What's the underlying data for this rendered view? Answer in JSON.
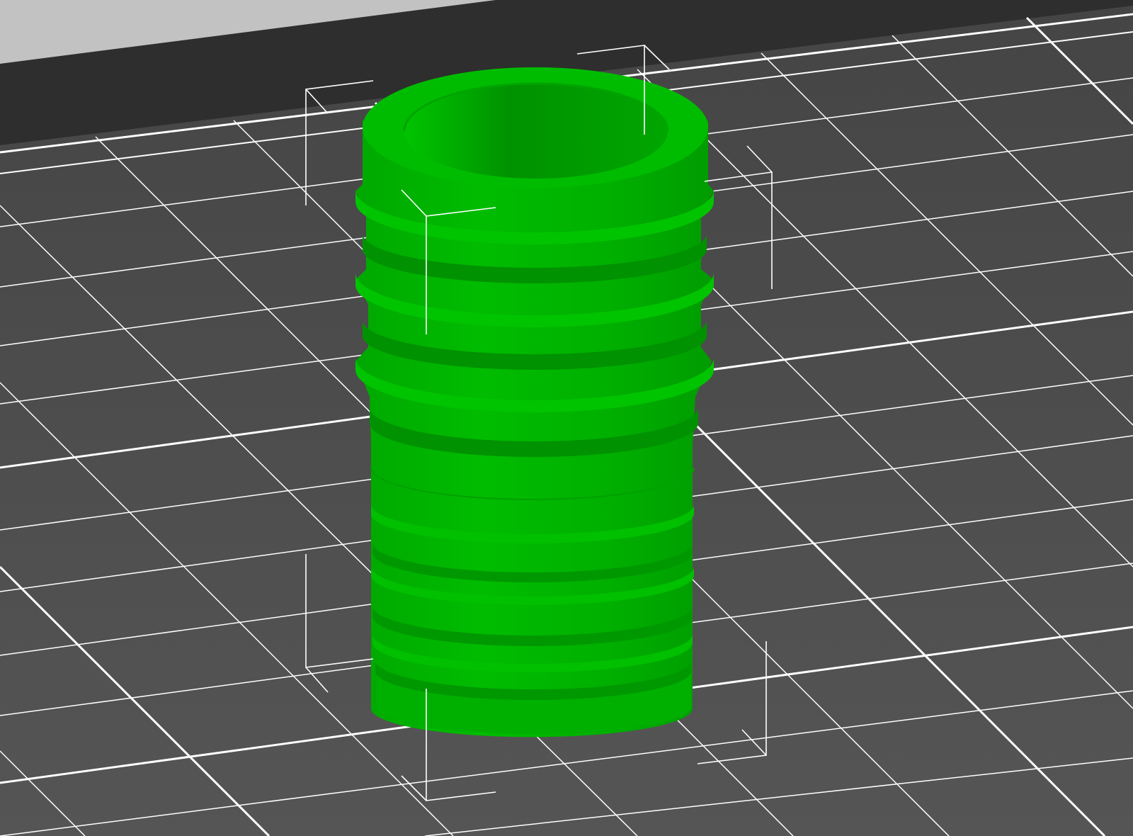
{
  "viewport": {
    "view": "3d-perspective",
    "background_color": "#2e2e2e",
    "bed": {
      "plate_color": "#4b4b4b",
      "grid_color": "#ffffff",
      "grid_major_color": "#ffffff"
    },
    "model": {
      "shape": "ribbed hose barb cylinder",
      "state": "selected",
      "color": "#00b400",
      "shade_color": "#008f00",
      "highlight_color": "#00c800"
    },
    "selection_box": {
      "visible": true,
      "color": "#ffffff"
    }
  }
}
